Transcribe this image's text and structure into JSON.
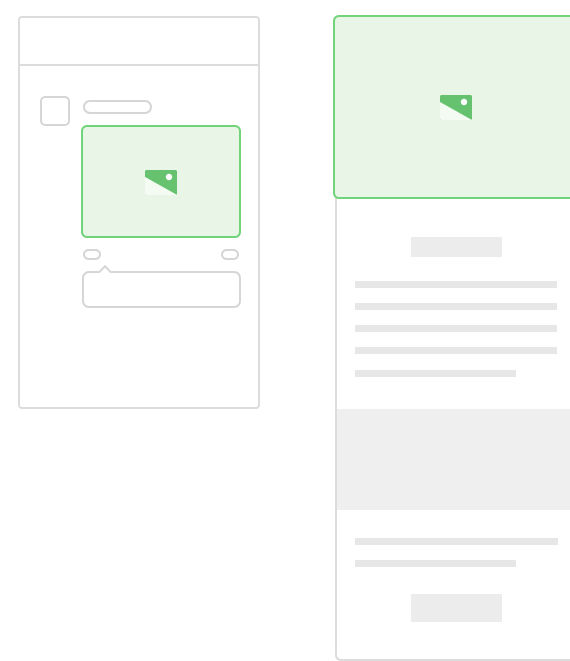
{
  "left_wireframe": {
    "kind": "social-post-mockup",
    "media_icon": "image-icon",
    "accent_color": "#72d47a",
    "media_fill_color": "#e9f5e7"
  },
  "right_wireframe": {
    "kind": "email-layout-mockup",
    "hero_icon": "image-icon",
    "text_lines_upper": 5,
    "text_lines_lower": 2
  },
  "colors": {
    "outline": "#dcdcdc",
    "placeholder_fill": "#ececec",
    "green_outline": "#72d47a",
    "green_fill": "#e9f5e7",
    "icon_green": "#67c270"
  }
}
